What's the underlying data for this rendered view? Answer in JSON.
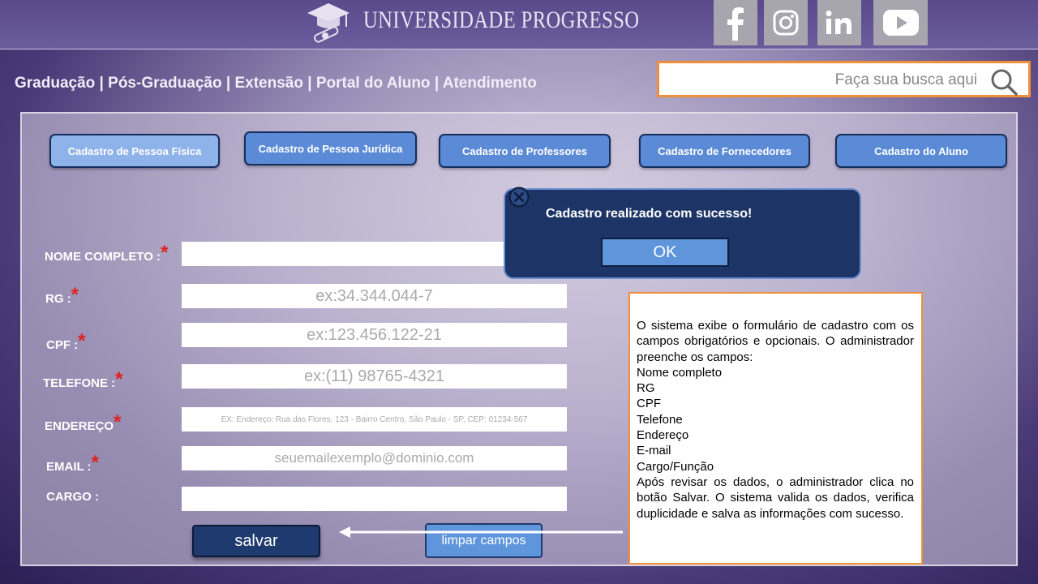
{
  "header": {
    "brand": "UNIVERSIDADE PROGRESSO",
    "social": [
      {
        "name": "facebook-icon",
        "glyph": "f"
      },
      {
        "name": "instagram-icon",
        "glyph": "ig"
      },
      {
        "name": "linkedin-icon",
        "glyph": "in"
      },
      {
        "name": "youtube-icon",
        "glyph": "yt"
      }
    ]
  },
  "nav": {
    "items": [
      "Graduação",
      "Pós-Graduação",
      "Extensão",
      "Portal do Aluno",
      "Atendimento"
    ],
    "separator": " | "
  },
  "search": {
    "placeholder": "Faça sua busca aqui"
  },
  "tabs": [
    "Cadastro de Pessoa Física",
    "Cadastro de Pessoa Jurídica",
    "Cadastro de Professores",
    "Cadastro de  Fornecedores",
    "Cadastro do Aluno"
  ],
  "form": {
    "nome": {
      "label": "NOME COMPLETO :",
      "placeholder": ""
    },
    "rg": {
      "label": "RG :",
      "placeholder": "ex:34.344.044-7"
    },
    "cpf": {
      "label": "CPF :",
      "placeholder": "ex:123.456.122-21"
    },
    "telefone": {
      "label": "TELEFONE :",
      "placeholder": "ex:(11) 98765-4321"
    },
    "endereco": {
      "label": "ENDEREÇO",
      "placeholder": "EX: Endereço: Rua das Flores, 123 - Bairro Centro, São Paulo - SP, CEP: 01234-567"
    },
    "email": {
      "label": "EMAIL :",
      "placeholder": "seuemailexemplo@dominio.com"
    },
    "cargo": {
      "label": "CARGO :",
      "placeholder": ""
    },
    "required_mark": "*"
  },
  "modal": {
    "message": "Cadastro realizado com sucesso!",
    "ok_label": "OK"
  },
  "actions": {
    "save_label": "salvar",
    "clear_label": "limpar campos"
  },
  "note": {
    "intro": "O sistema exibe o formulário de cadastro com os campos obrigatórios e opcionais. O administrador preenche os campos:",
    "fields": [
      "Nome completo",
      "RG",
      "CPF",
      "Telefone",
      "Endereço",
      "E-mail",
      "Cargo/Função"
    ],
    "outro": "Após revisar os dados, o administrador clica no botão Salvar. O sistema valida os dados, verifica duplicidade e salva as informações com sucesso."
  },
  "colors": {
    "accent": "#5b8bd6",
    "search_border": "#ef8f3a",
    "modal_bg": "#1d3566",
    "required": "#e02020"
  }
}
